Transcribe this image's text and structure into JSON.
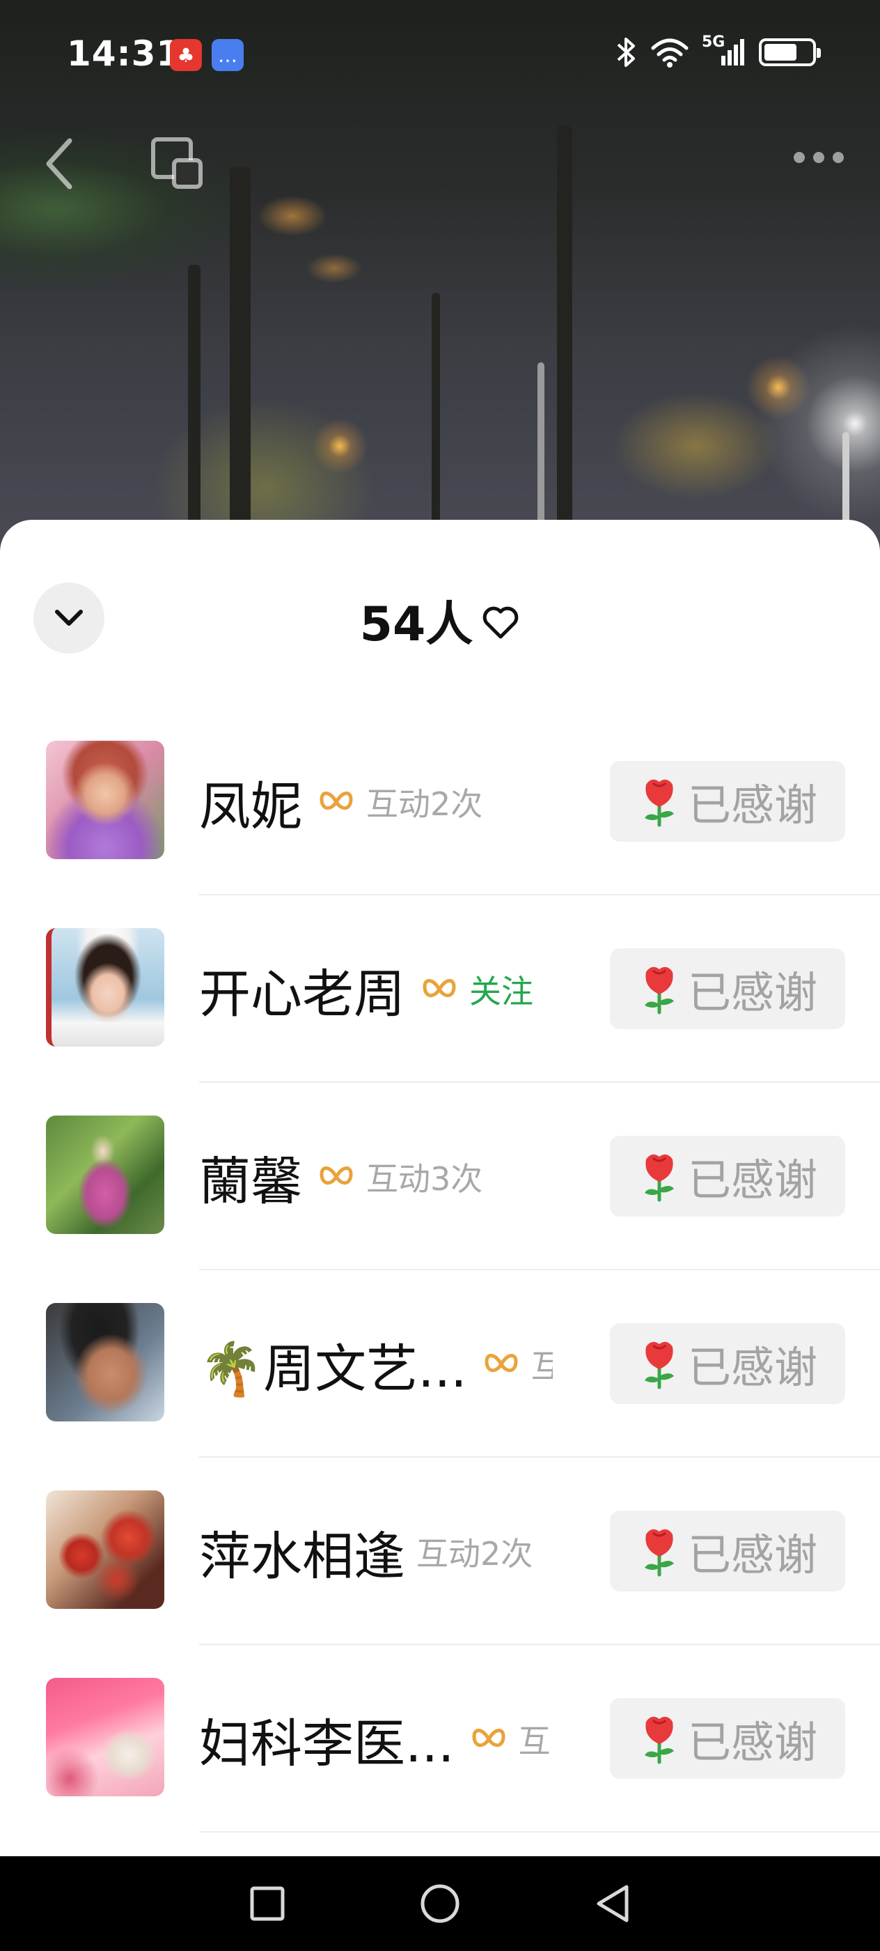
{
  "status_bar": {
    "time": "14:31",
    "network": "5G",
    "notification_icons": [
      "game-app-icon",
      "message-app-icon"
    ],
    "status_icons": [
      "bluetooth-icon",
      "wifi-icon",
      "signal-icon",
      "battery-icon"
    ]
  },
  "nav": {
    "back_icon": "chevron-left-icon",
    "window_icon": "floating-window-icon",
    "more_icon": "more-dots-icon"
  },
  "sheet": {
    "title": "54人",
    "title_icon": "heart-outline-icon",
    "collapse_icon": "chevron-down-icon",
    "items": [
      {
        "name": "凤妮",
        "meta": "互动2次",
        "meta_type": "interaction",
        "has_badge": true,
        "button": "已感谢"
      },
      {
        "name": "开心老周",
        "meta": "关注",
        "meta_type": "follow",
        "has_badge": true,
        "button": "已感谢"
      },
      {
        "name": "蘭馨",
        "meta": "互动3次",
        "meta_type": "interaction",
        "has_badge": true,
        "button": "已感谢"
      },
      {
        "name": "🌴周文艺...",
        "meta": "互",
        "meta_type": "interaction",
        "has_badge": true,
        "button": "已感谢"
      },
      {
        "name": "萍水相逢",
        "meta": "互动2次",
        "meta_type": "interaction",
        "has_badge": false,
        "button": "已感谢"
      },
      {
        "name": "妇科李医...",
        "meta": "互",
        "meta_type": "interaction",
        "has_badge": true,
        "button": "已感谢"
      }
    ]
  },
  "colors": {
    "badge": "#e9a33a",
    "follow": "#23a84e",
    "rose_red": "#e8393b",
    "rose_green": "#3aa647"
  }
}
